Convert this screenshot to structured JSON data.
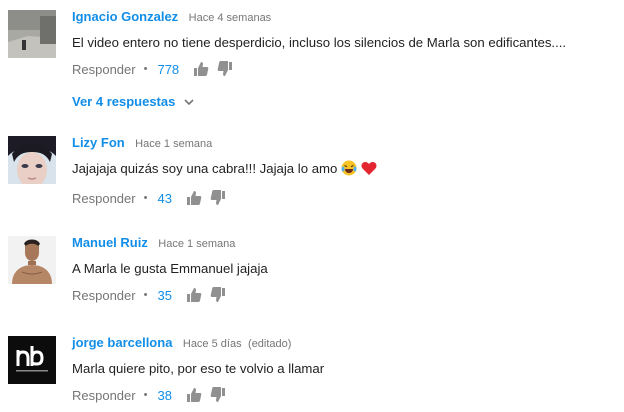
{
  "comments": [
    {
      "author": "Ignacio Gonzalez",
      "time": "Hace 4 semanas",
      "edited": "",
      "text": "El video entero no tiene desperdicio, incluso los silencios de Marla son edificantes....",
      "reply_label": "Responder",
      "separator": "•",
      "likes": "778",
      "replies_label": "Ver 4 respuestas"
    },
    {
      "author": "Lizy Fon",
      "time": "Hace 1 semana",
      "edited": "",
      "text": "Jajajaja quizás soy una cabra!!! Jajaja lo amo",
      "emojis": [
        "laughing-crying-emoji",
        "red-heart-emoji"
      ],
      "reply_label": "Responder",
      "separator": "•",
      "likes": "43"
    },
    {
      "author": "Manuel Ruiz",
      "time": "Hace 1 semana",
      "edited": "",
      "text": "A Marla le gusta Emmanuel jajaja",
      "reply_label": "Responder",
      "separator": "•",
      "likes": "35"
    },
    {
      "author": "jorge barcellona",
      "time": "Hace 5 días",
      "edited": "(editado)",
      "text": "Marla quiere pito, por eso te volvio a llamar",
      "reply_label": "Responder",
      "separator": "•",
      "likes": "38"
    }
  ],
  "colors": {
    "author": "#128ee9",
    "meta": "#767676",
    "text": "#222222",
    "likes": "#128ee9"
  },
  "icons": [
    "thumbs-up-icon",
    "thumbs-down-icon",
    "chevron-down-icon"
  ]
}
